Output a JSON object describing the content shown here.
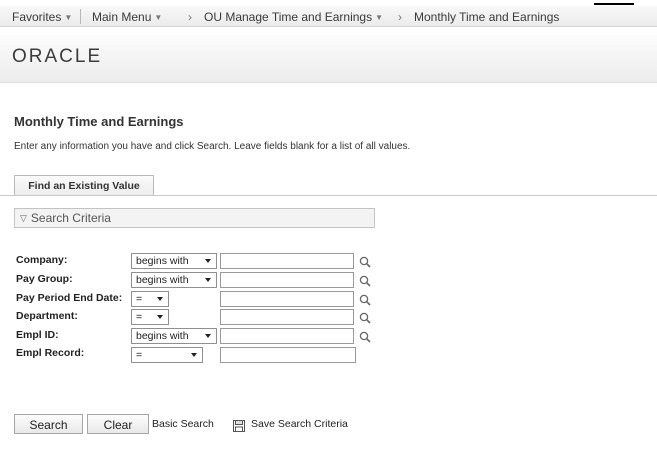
{
  "nav": {
    "favorites": "Favorites",
    "main_menu": "Main Menu",
    "crumb_sep": "›",
    "breadcrumb_1": "OU Manage Time and Earnings",
    "breadcrumb_2": "Monthly Time and Earnings"
  },
  "brand": {
    "logo": "ORACLE"
  },
  "page": {
    "title": "Monthly Time and Earnings",
    "instructions": "Enter any information you have and click Search. Leave fields blank for a list of all values.",
    "tab_label": "Find an Existing Value",
    "criteria_label": "Search Criteria"
  },
  "fields": [
    {
      "label": "Company:",
      "operator": "begins with",
      "value": "",
      "lookup": true
    },
    {
      "label": "Pay Group:",
      "operator": "begins with",
      "value": "",
      "lookup": true
    },
    {
      "label": "Pay Period End Date:",
      "operator": "=",
      "value": "",
      "lookup": true
    },
    {
      "label": "Department:",
      "operator": "=",
      "value": "",
      "lookup": true
    },
    {
      "label": "Empl ID:",
      "operator": "begins with",
      "value": "",
      "lookup": true
    },
    {
      "label": "Empl Record:",
      "operator": "=",
      "value": "",
      "lookup": false
    }
  ],
  "actions": {
    "search": "Search",
    "clear": "Clear",
    "basic_search": "Basic Search",
    "save_search": "Save Search Criteria"
  },
  "colors": {
    "header_bg": "#f2f2f2",
    "border": "#c3c3c3",
    "text": "#333333"
  },
  "icons": {
    "lookup": "magnifier-icon",
    "save": "floppy-disk-icon",
    "expand": "triangle-down-icon",
    "dropdown": "chevron-down-icon"
  }
}
